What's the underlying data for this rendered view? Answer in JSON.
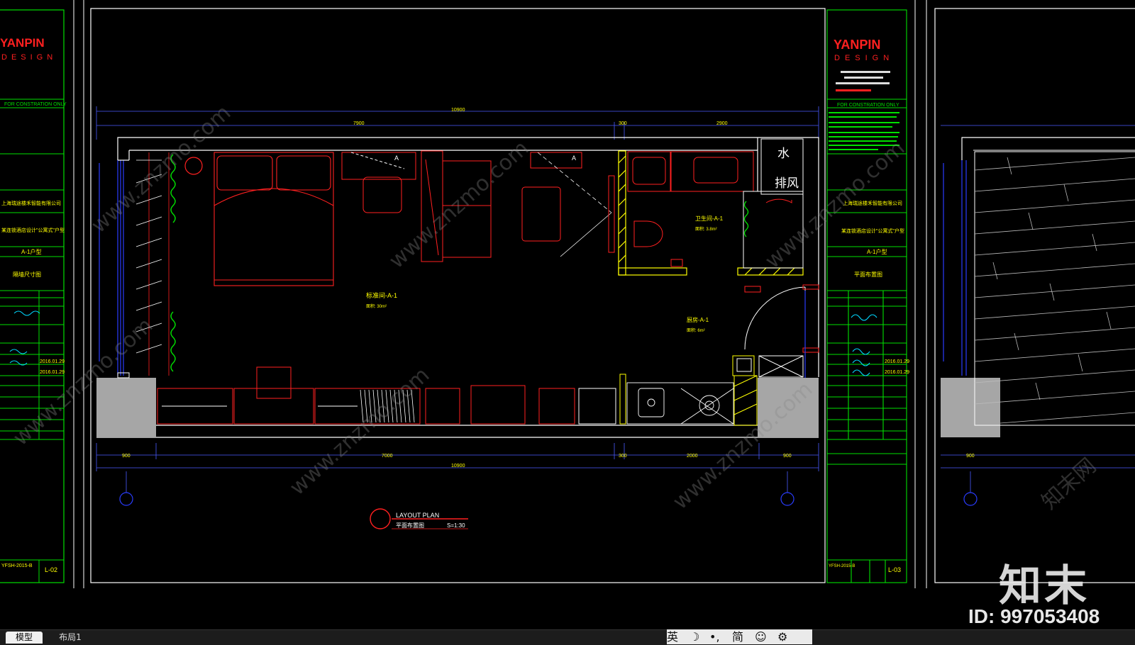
{
  "tabs": {
    "model": "模型",
    "layout1": "布局1"
  },
  "ime": {
    "lang": "英",
    "moon": "☽",
    "punct": "•,",
    "simplified": "简",
    "emoji": "☺",
    "settings": "⚙"
  },
  "watermark": {
    "brand_cn": "知末",
    "id": "ID: 997053408",
    "repeat": "www.znzmo.com",
    "repeat_cn": "知末网"
  },
  "title_block": {
    "brand": "YANPIN",
    "design": "DESIGN",
    "construction": "FOR CONSTRATION ONLY",
    "client": "上海瑞途楼禾智能有限公司",
    "project": "某连锁酒店设计\"公寓式\"户型",
    "type": "A-1户型",
    "drawing_left": "隔墙尺寸图",
    "drawing_right": "平面布置图",
    "date": "2016.01.29",
    "sheet_left": "L-02",
    "sheet_right": "L-03",
    "code_left": "YFSH-2015-B",
    "code_right": "YFSH-2015-B"
  },
  "plan": {
    "dim_total": "10900",
    "dim_top_1": "7900",
    "dim_top_2": "300",
    "dim_top_3": "2900",
    "dim_bot_1": "900",
    "dim_bot_2": "7000",
    "dim_bot_3": "300",
    "dim_bot_4": "2000",
    "dim_bot_5": "900",
    "dim_right_900": "900",
    "label_water": "水",
    "label_vent": "排风",
    "room_main": "标准间-A-1",
    "room_main_area": "面积: 30m²",
    "room_bath": "卫生间-A-1",
    "room_bath_area": "面积: 3.8m²",
    "room_entry": "厨房-A-1",
    "room_entry_area": "面积: 6m²",
    "door_tag_a": "A",
    "plan_title": "LAYOUT PLAN",
    "plan_title_cn": "平面布置图",
    "plan_scale": "S=1:30"
  },
  "colors": {
    "background": "#000000",
    "frame": "#ffffff",
    "furniture": "#ff2020",
    "green": "#00e000",
    "blue": "#2a3cff",
    "yellow": "#ffff00",
    "gray": "#a6a6a6"
  }
}
